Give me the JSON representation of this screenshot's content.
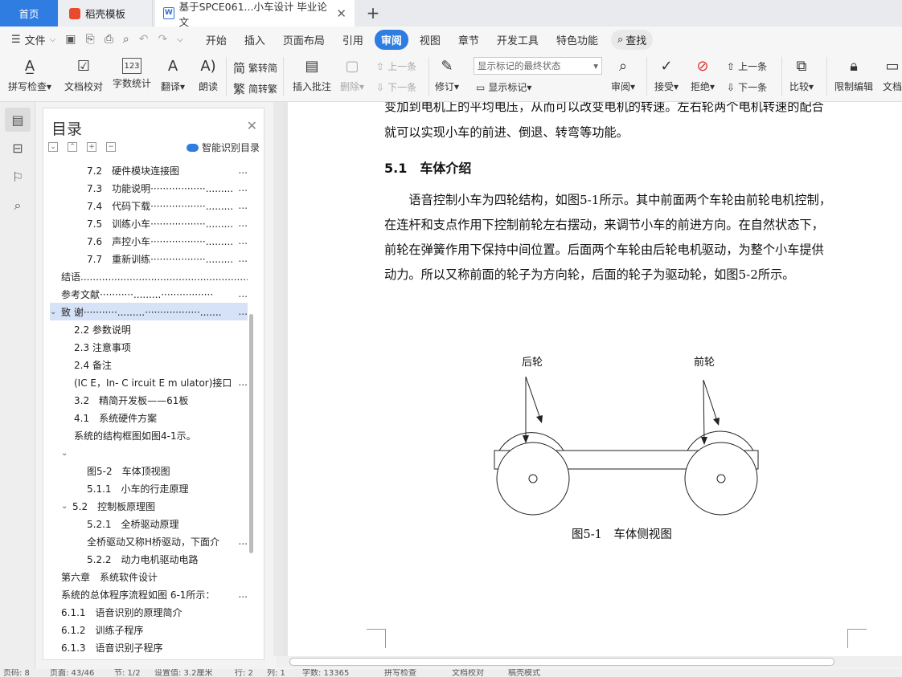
{
  "tabs": {
    "home": "首页",
    "template": "稻壳模板",
    "doc": "基于SPCE061...小车设计 毕业论文",
    "new_tab": "+"
  },
  "menu": {
    "file": "文件",
    "tabs": [
      "开始",
      "插入",
      "页面布局",
      "引用",
      "审阅",
      "视图",
      "章节",
      "开发工具",
      "特色功能"
    ],
    "active_tab": "审阅",
    "search": "查找"
  },
  "toolbar": {
    "spell_check": "拼写检查",
    "doc_proof": "文档校对",
    "word_count": "字数统计",
    "translate": "翻译",
    "read_aloud": "朗读",
    "to_traditional": "繁转简",
    "to_simplified": "简转繁",
    "insert_comment": "插入批注",
    "delete": "删除",
    "prev_comment": "上一条",
    "next_comment": "下一条",
    "track_changes": "修订",
    "markup_state": "显示标记的最终状态",
    "show_markup": "显示标记",
    "review": "审阅",
    "accept": "接受",
    "reject": "拒绝",
    "prev_change": "上一条",
    "next_change": "下一条",
    "compare": "比较",
    "restrict_edit": "限制编辑",
    "doc_more": "文档"
  },
  "toc": {
    "title": "目录",
    "smart_toc": "智能识别目录",
    "items": [
      {
        "text": "7.2　硬件模块连接图",
        "dots": "...",
        "indent": 2,
        "caret": ""
      },
      {
        "text": "7.3　功能说明··················.........",
        "dots": "...",
        "indent": 2,
        "caret": ""
      },
      {
        "text": "7.4　代码下载··················.........",
        "dots": "...",
        "indent": 2,
        "caret": ""
      },
      {
        "text": "7.5　训练小车··················.........",
        "dots": "...",
        "indent": 2,
        "caret": ""
      },
      {
        "text": "7.6　声控小车··················.........",
        "dots": "...",
        "indent": 2,
        "caret": ""
      },
      {
        "text": "7.7　重新训练··················.........",
        "dots": "...",
        "indent": 2,
        "caret": ""
      },
      {
        "text": "结语.........................................................................",
        "dots": "",
        "indent": 0,
        "caret": ""
      },
      {
        "text": "参考文献···········.........·················",
        "dots": "...",
        "indent": 0,
        "caret": ""
      },
      {
        "text": "致 谢···········.........··················.......",
        "dots": "...",
        "indent": 0,
        "caret": "⌄",
        "selected": true
      },
      {
        "text": "2.2  参数说明",
        "dots": "",
        "indent": 1,
        "caret": ""
      },
      {
        "text": "2.3  注意事项",
        "dots": "",
        "indent": 1,
        "caret": ""
      },
      {
        "text": "2.4  备注",
        "dots": "",
        "indent": 1,
        "caret": ""
      },
      {
        "text": "(IC E，In- C ircuit E m ulator)接口",
        "dots": "...",
        "indent": 1,
        "caret": ""
      },
      {
        "text": "3.2　精简开发板——61板",
        "dots": "",
        "indent": 1,
        "caret": ""
      },
      {
        "text": "4.1　系统硬件方案",
        "dots": "",
        "indent": 1,
        "caret": ""
      },
      {
        "text": "系统的结构框图如图4-1示。",
        "dots": "",
        "indent": 1,
        "caret": ""
      },
      {
        "text": "",
        "dots": "",
        "indent": 0,
        "caret": "⌄",
        "pad": 1
      },
      {
        "text": "图5-2　车体顶视图",
        "dots": "",
        "indent": 2,
        "caret": ""
      },
      {
        "text": "5.1.1　小车的行走原理",
        "dots": "",
        "indent": 2,
        "caret": ""
      },
      {
        "text": "5.2　控制板原理图",
        "dots": "",
        "indent": 0,
        "caret": "⌄",
        "pad": 1
      },
      {
        "text": "5.2.1　全桥驱动原理",
        "dots": "",
        "indent": 2,
        "caret": ""
      },
      {
        "text": "全桥驱动又称H桥驱动，下面介",
        "dots": "...",
        "indent": 2,
        "caret": ""
      },
      {
        "text": "5.2.2　动力电机驱动电路",
        "dots": "",
        "indent": 2,
        "caret": ""
      },
      {
        "text": "第六章　系统软件设计",
        "dots": "",
        "indent": 0,
        "caret": ""
      },
      {
        "text": "系统的总体程序流程如图 6-1所示：",
        "dots": "...",
        "indent": 0,
        "caret": ""
      },
      {
        "text": "6.1.1　语音识别的原理简介",
        "dots": "",
        "indent": 0,
        "caret": ""
      },
      {
        "text": "6.1.2　训练子程序",
        "dots": "",
        "indent": 0,
        "caret": ""
      },
      {
        "text": "6.1.3　语音识别子程序",
        "dots": "",
        "indent": 0,
        "caret": ""
      }
    ]
  },
  "document": {
    "para_top_1": "变加到电机上的平均电压，从而可以改变电机的转速。左右轮两个电机转速的配合",
    "para_top_2": "就可以实现小车的前进、倒退、转弯等功能。",
    "section_heading": "5.1　车体介绍",
    "body_lines": [
      "　　语音控制小车为四轮结构，如图5-1所示。其中前面两个车轮由前轮电机控制，",
      "在连杆和支点作用下控制前轮左右摆动，来调节小车的前进方向。在自然状态下，",
      "前轮在弹簧作用下保持中间位置。后面两个车轮由后轮电机驱动，为整个小车提供",
      "动力。所以又称前面的轮子为方向轮，后面的轮子为驱动轮，如图5-2所示。"
    ],
    "figure_label_rear": "后轮",
    "figure_label_front": "前轮",
    "figure_caption": "图5-1　车体侧视图"
  },
  "status": {
    "page": "页码: 8",
    "pages": "页面: 43/46",
    "section": "节: 1/2",
    "settings": "设置值: 3.2厘米",
    "row": "行: 2",
    "col": "列: 1",
    "words": "字数: 13365",
    "spell": "拼写检查",
    "proof": "文档校对",
    "mode": "稿壳模式"
  }
}
